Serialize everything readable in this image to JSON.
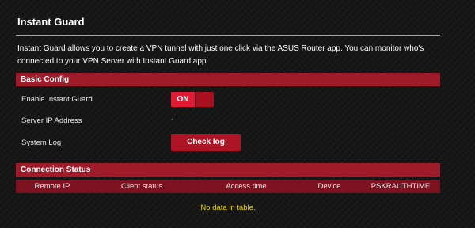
{
  "page": {
    "title": "Instant Guard",
    "description": "Instant Guard allows you to create a VPN tunnel with just one click via the ASUS Router app. You can monitor who's connected to your VPN Server with Instant Guard app."
  },
  "basic_config": {
    "header": "Basic Config",
    "enable_label": "Enable Instant Guard",
    "enable_toggle_text": "ON",
    "server_ip_label": "Server IP Address",
    "server_ip_value": "-",
    "system_log_label": "System Log",
    "check_log_label": "Check log"
  },
  "connection_status": {
    "header": "Connection Status",
    "columns": [
      "Remote IP",
      "Client status",
      "Access time",
      "Device",
      "PSKRAUTHTIME"
    ],
    "empty_text": "No data in table."
  },
  "colors": {
    "section_header": "#9e1c2a",
    "toggle_on": "#e01a32",
    "button": "#ad1426",
    "empty_text": "#e6d400"
  }
}
